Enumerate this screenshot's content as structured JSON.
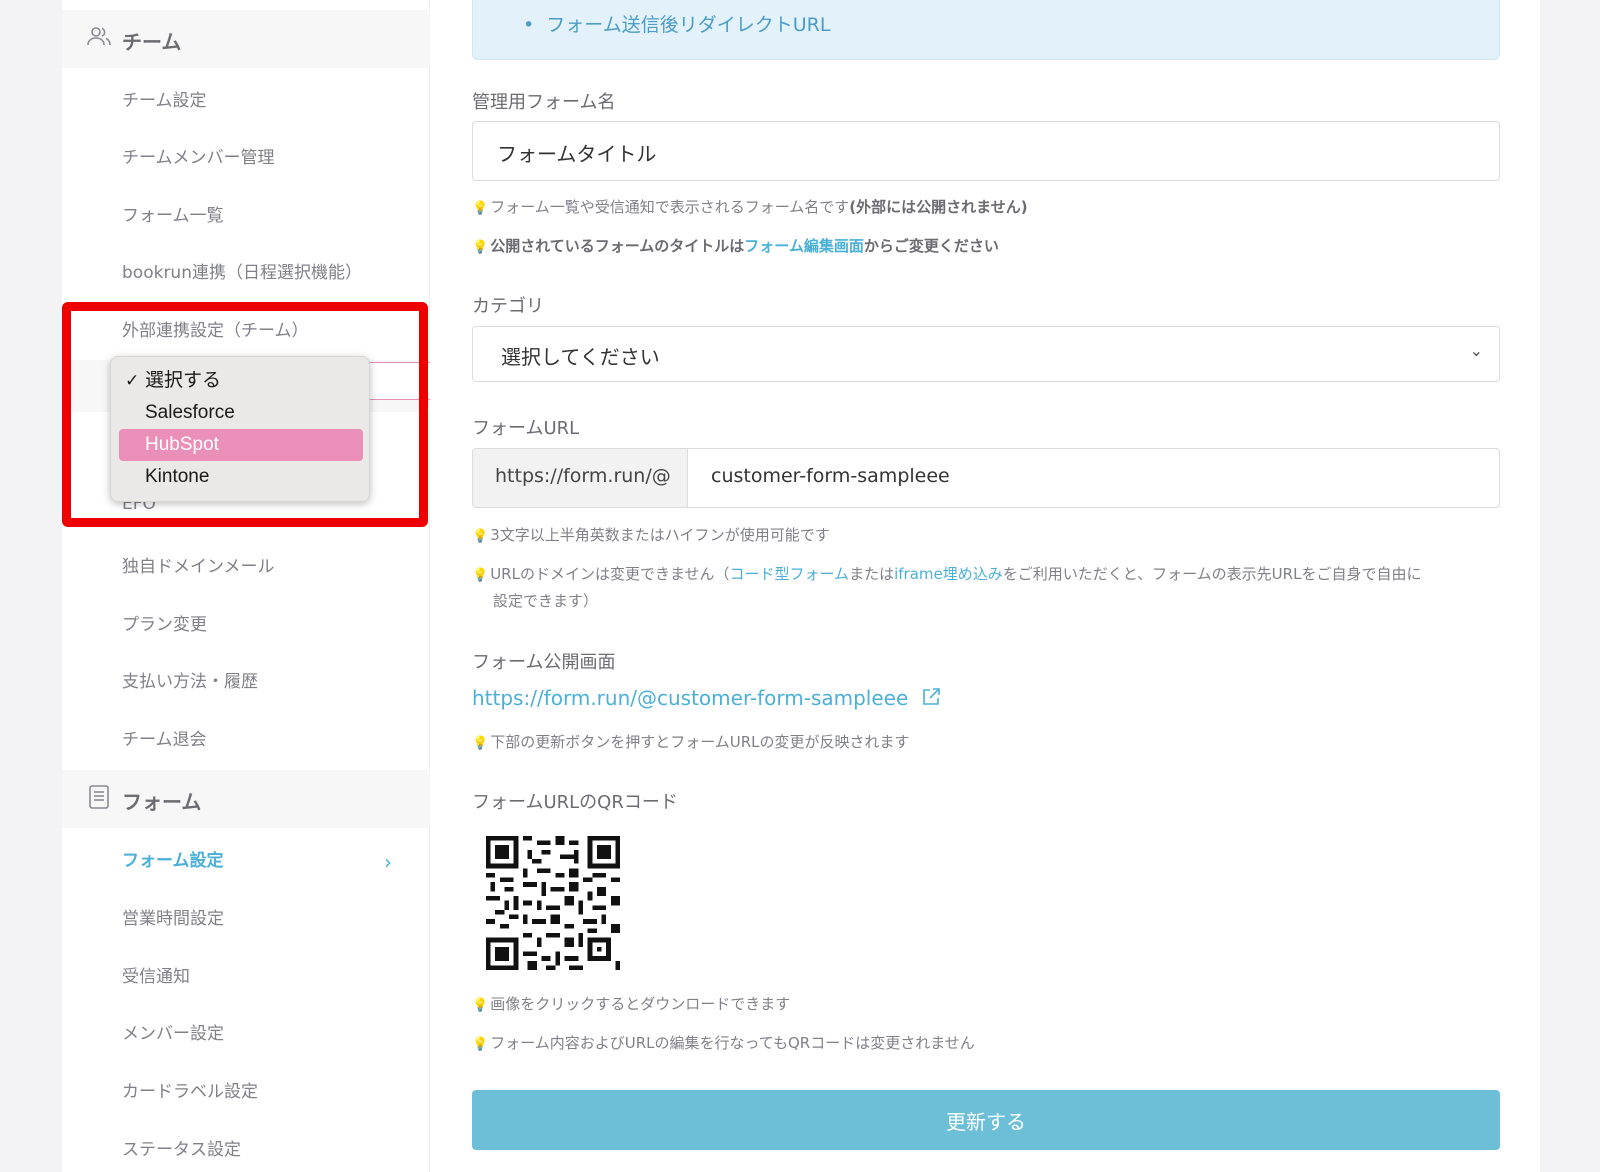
{
  "sidebar": {
    "team_section": {
      "title": "チーム",
      "icon": "team-icon"
    },
    "team_items": [
      {
        "label": "チーム設定"
      },
      {
        "label": "チームメンバー管理"
      },
      {
        "label": "フォーム一覧"
      },
      {
        "label": "bookrun連携（日程選択機能）"
      },
      {
        "label": "外部連携設定（チーム）"
      },
      {
        "label": "EFO"
      },
      {
        "label": "独自ドメインメール"
      },
      {
        "label": "プラン変更"
      },
      {
        "label": "支払い方法・履歴"
      },
      {
        "label": "チーム退会"
      }
    ],
    "form_section": {
      "title": "フォーム",
      "icon": "document-icon"
    },
    "form_items": [
      {
        "label": "フォーム設定"
      },
      {
        "label": "営業時間設定"
      },
      {
        "label": "受信通知"
      },
      {
        "label": "メンバー設定"
      },
      {
        "label": "カードラベル設定"
      },
      {
        "label": "ステータス設定"
      }
    ],
    "active_color": "#4bb0d8"
  },
  "integration_dropdown": {
    "options": [
      {
        "label": "選択する",
        "checked": true
      },
      {
        "label": "Salesforce"
      },
      {
        "label": "HubSpot",
        "highlighted": true
      },
      {
        "label": "Kintone"
      }
    ],
    "highlight_color": "#e98fb8"
  },
  "annotation": {
    "color": "#ee0000"
  },
  "main": {
    "info_bullet": "フォーム送信後リダイレクトURL",
    "admin_form_name": {
      "label": "管理用フォーム名",
      "value": "フォームタイトル",
      "hint1": "フォーム一覧や受信通知で表示されるフォーム名です",
      "hint1_bold": "(外部には公開されません)",
      "hint2_pre": "公開されているフォームのタイトルは",
      "hint2_link": "フォーム編集画面",
      "hint2_post": "からご変更ください"
    },
    "category": {
      "label": "カテゴリ",
      "value": "選択してください"
    },
    "form_url": {
      "label": "フォームURL",
      "prefix": "https://form.run/@",
      "value": "customer-form-sampleee",
      "hint1": "3文字以上半角英数またはハイフンが使用可能です",
      "hint2_pre": "URLのドメインは変更できません（",
      "hint2_link1": "コード型フォーム",
      "hint2_mid": "または",
      "hint2_link2": "iframe埋め込み",
      "hint2_post": "をご利用いただくと、フォームの表示先URLをご自身で自由に",
      "hint2_line2": "設定できます）"
    },
    "public_page": {
      "label": "フォーム公開画面",
      "url": "https://form.run/@customer-form-sampleee",
      "hint": "下部の更新ボタンを押すとフォームURLの変更が反映されます"
    },
    "qr": {
      "label": "フォームURLのQRコード",
      "hint1": "画像をクリックするとダウンロードできます",
      "hint2": "フォーム内容およびURLの編集を行なってもQRコードは変更されません"
    },
    "update_button": "更新する",
    "button_color": "#6dbfd8"
  }
}
